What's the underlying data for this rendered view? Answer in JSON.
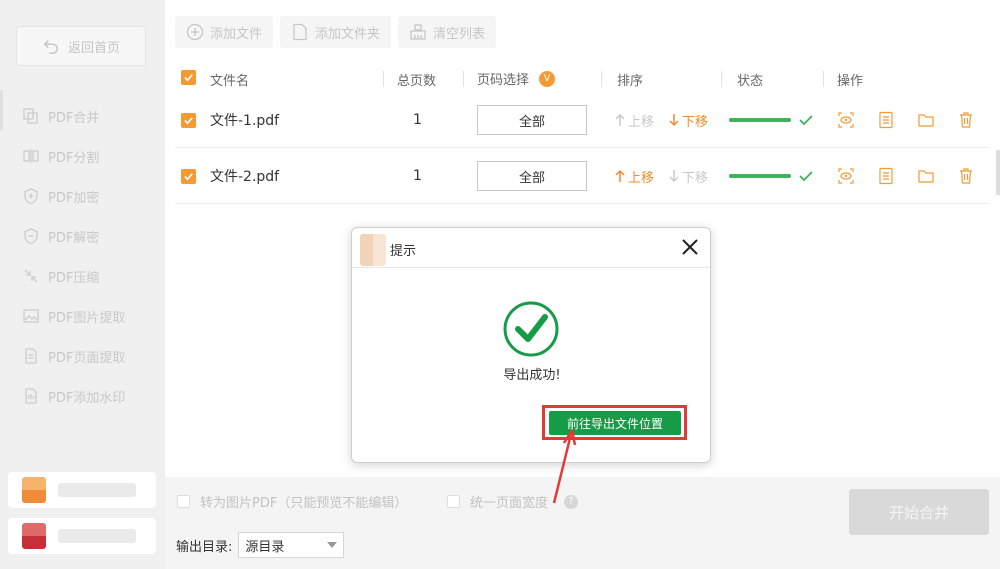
{
  "sidebar": {
    "back_label": "返回首页",
    "items": [
      {
        "label": "PDF合并",
        "icon": "merge-icon"
      },
      {
        "label": "PDF分割",
        "icon": "split-icon"
      },
      {
        "label": "PDF加密",
        "icon": "lock-shield-icon"
      },
      {
        "label": "PDF解密",
        "icon": "unlock-shield-icon"
      },
      {
        "label": "PDF压缩",
        "icon": "compress-icon"
      },
      {
        "label": "PDF图片提取",
        "icon": "image-icon"
      },
      {
        "label": "PDF页面提取",
        "icon": "page-icon"
      },
      {
        "label": "PDF添加水印",
        "icon": "watermark-icon"
      }
    ]
  },
  "toolbar": {
    "add_file": "添加文件",
    "add_folder": "添加文件夹",
    "clear_list": "清空列表"
  },
  "table": {
    "headers": {
      "filename": "文件名",
      "pages": "总页数",
      "page_select": "页码选择",
      "sort": "排序",
      "status": "状态",
      "actions": "操作"
    },
    "page_select_badge": "V",
    "rows": [
      {
        "filename": "文件-1.pdf",
        "pages": "1",
        "page_range": "全部",
        "up": "上移",
        "down": "下移",
        "up_enabled": false,
        "down_enabled": true
      },
      {
        "filename": "文件-2.pdf",
        "pages": "1",
        "page_range": "全部",
        "up": "上移",
        "down": "下移",
        "up_enabled": true,
        "down_enabled": false
      }
    ]
  },
  "options": {
    "to_image_pdf": "转为图片PDF（只能预览不能编辑）",
    "unify_width": "统一页面宽度",
    "help_icon": "?",
    "output_dir_label": "输出目录:",
    "output_dir_value": "源目录",
    "start_button": "开始合并"
  },
  "dialog": {
    "title": "提示",
    "message": "导出成功!",
    "go_button": "前往导出文件位置"
  },
  "colors": {
    "accent_orange": "#f39a32",
    "success_green": "#169b47",
    "highlight_red": "#e53935"
  }
}
